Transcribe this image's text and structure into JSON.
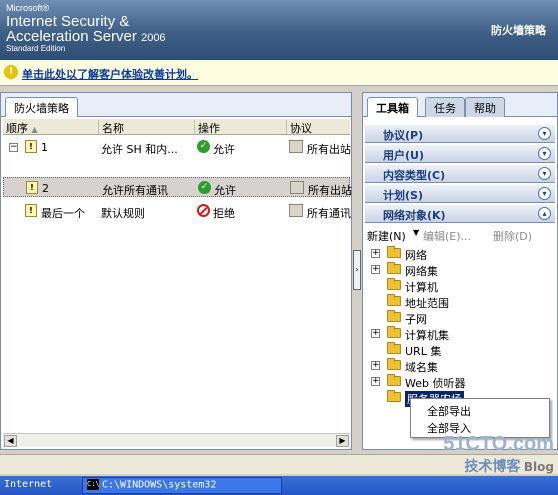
{
  "brand": {
    "microsoft": "Microsoft®",
    "line1": "Internet Security &",
    "line2": "Acceleration Server",
    "year": "2006",
    "edition": "Standard Edition"
  },
  "header_title": "防火墙策略",
  "info_bar": {
    "text": "单击此处以了解客户体验改善计划。"
  },
  "left_panel": {
    "tab": "防火墙策略",
    "columns": [
      "顺序",
      "名称",
      "操作",
      "协议"
    ],
    "rows": [
      {
        "order": "1",
        "name": "允许 SH 和内...",
        "action": "允许",
        "protocol": "所有出站"
      },
      {
        "order": "2",
        "name": "允许所有通讯",
        "action": "允许",
        "protocol": "所有出站"
      },
      {
        "order": "最后一个",
        "name": "默认规则",
        "action": "拒绝",
        "protocol": "所有通讯"
      }
    ]
  },
  "right_panel": {
    "tabs": [
      "工具箱",
      "任务",
      "帮助"
    ],
    "sections": [
      "协议(P)",
      "用户(U)",
      "内容类型(C)",
      "计划(S)",
      "网络对象(K)"
    ],
    "toolbar": {
      "new": "新建(N)",
      "edit": "编辑(E)...",
      "delete": "删除(D)"
    },
    "tree": [
      "网络",
      "网络集",
      "计算机",
      "地址范围",
      "子网",
      "计算机集",
      "URL 集",
      "域名集",
      "Web 侦听器",
      "服务器农场"
    ],
    "tree_has_expander": [
      true,
      true,
      false,
      false,
      false,
      true,
      false,
      true,
      true,
      false
    ]
  },
  "context_menu": [
    "全部导出",
    "全部导入"
  ],
  "taskbar": {
    "item1": "Internet",
    "item2": "C:\\WINDOWS\\system32"
  },
  "watermark": {
    "w1": "51CTO.com",
    "w2": "技术博客",
    "w3": "Blog"
  }
}
